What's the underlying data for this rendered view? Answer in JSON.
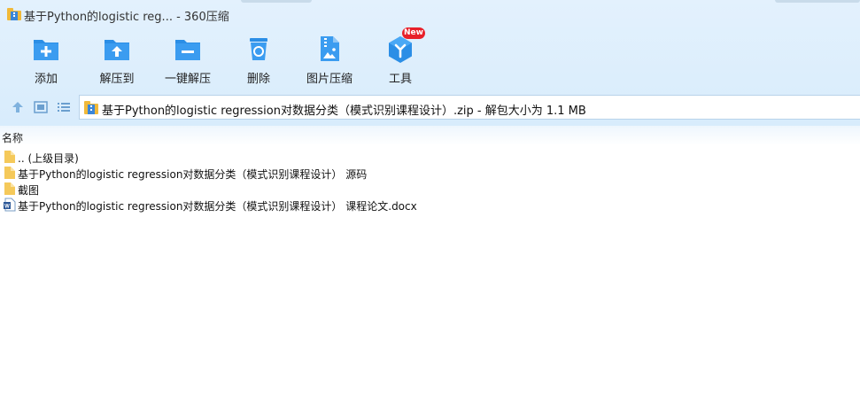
{
  "window": {
    "title": "基于Python的logistic reg... - 360压缩"
  },
  "toolbar": {
    "items": [
      {
        "label": "添加",
        "icon": "add-icon"
      },
      {
        "label": "解压到",
        "icon": "extract-to-icon"
      },
      {
        "label": "一键解压",
        "icon": "one-click-extract-icon"
      },
      {
        "label": "删除",
        "icon": "delete-icon"
      },
      {
        "label": "图片压缩",
        "icon": "image-compress-icon"
      },
      {
        "label": "工具",
        "icon": "tools-icon",
        "badge": "New"
      }
    ]
  },
  "address": {
    "path": "基于Python的logistic regression对数据分类（模式识别课程设计）.zip - 解包大小为 1.1 MB"
  },
  "list": {
    "column_name": "名称",
    "rows": [
      {
        "name": ".. (上级目录)",
        "type": "folder"
      },
      {
        "name": "基于Python的logistic regression对数据分类（模式识别课程设计） 源码",
        "type": "folder"
      },
      {
        "name": "截图",
        "type": "folder"
      },
      {
        "name": "基于Python的logistic regression对数据分类（模式识别课程设计） 课程论文.docx",
        "type": "docx"
      }
    ]
  },
  "colors": {
    "accent": "#2b8ee6",
    "toolbar_bg": "#dcedfc",
    "badge": "#e8202a",
    "folder": "#f5c95a"
  }
}
